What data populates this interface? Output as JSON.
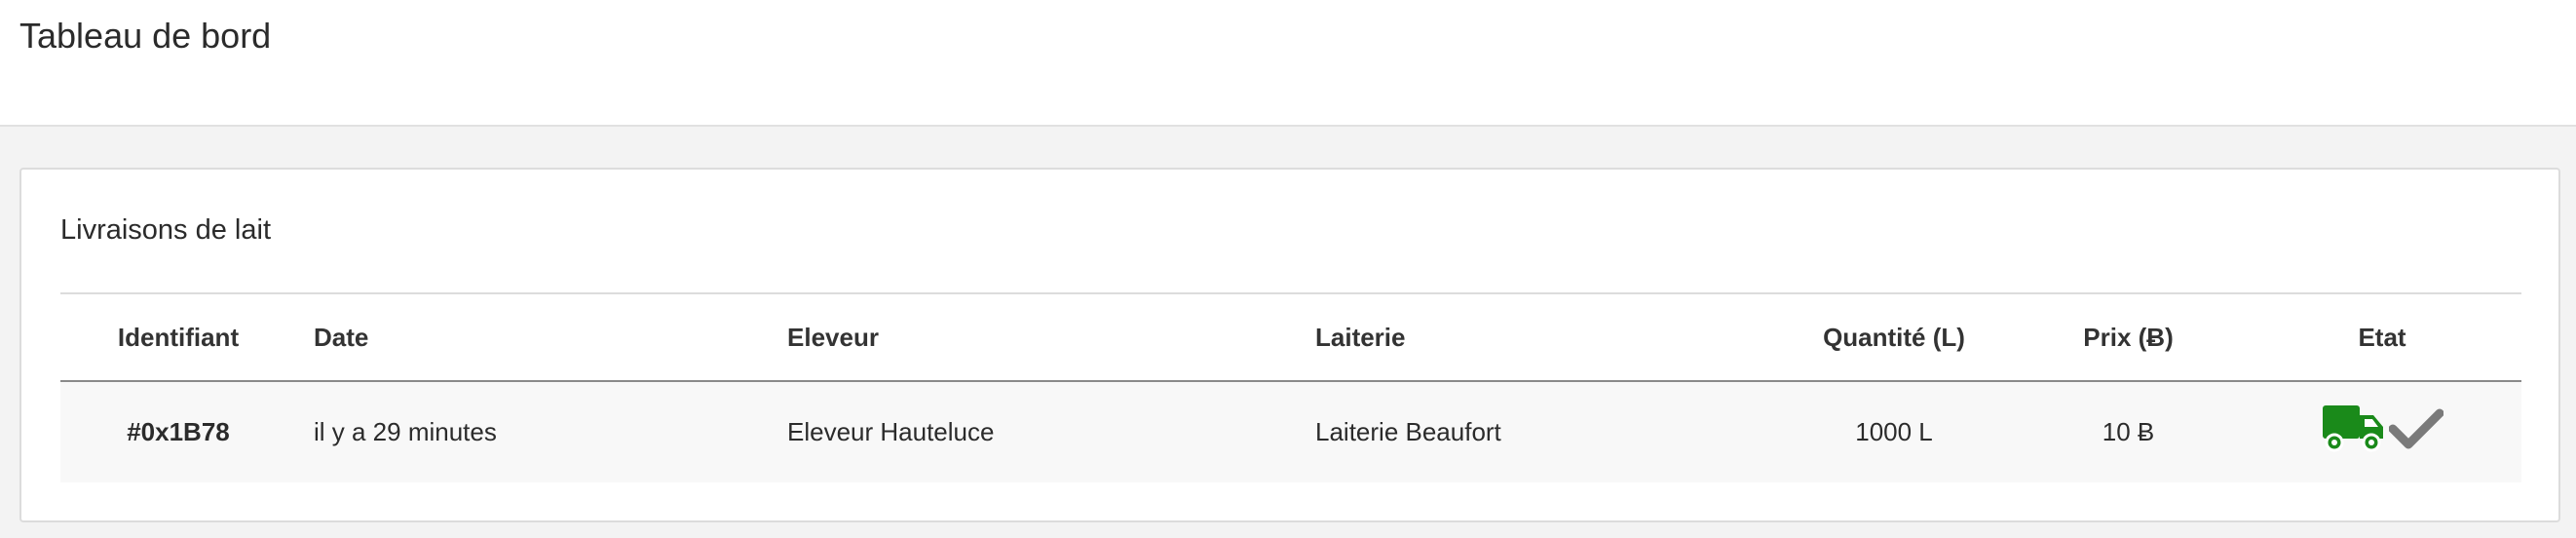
{
  "header": {
    "title": "Tableau de bord"
  },
  "card": {
    "title": "Livraisons de lait"
  },
  "table": {
    "columns": [
      "Identifiant",
      "Date",
      "Eleveur",
      "Laiterie",
      "Quantité (L)",
      "Prix (Ƀ)",
      "Etat"
    ],
    "rows": [
      {
        "id": "#0x1B78",
        "date": "il y a 29 minutes",
        "eleveur": "Eleveur Hauteluce",
        "laiterie": "Laiterie Beaufort",
        "quantite": "1000 L",
        "prix": "10 Ƀ",
        "etat_icons": [
          "truck-icon",
          "check-icon"
        ]
      }
    ]
  },
  "colors": {
    "truck": "#1a8a1a",
    "check": "#7a7a7a"
  }
}
